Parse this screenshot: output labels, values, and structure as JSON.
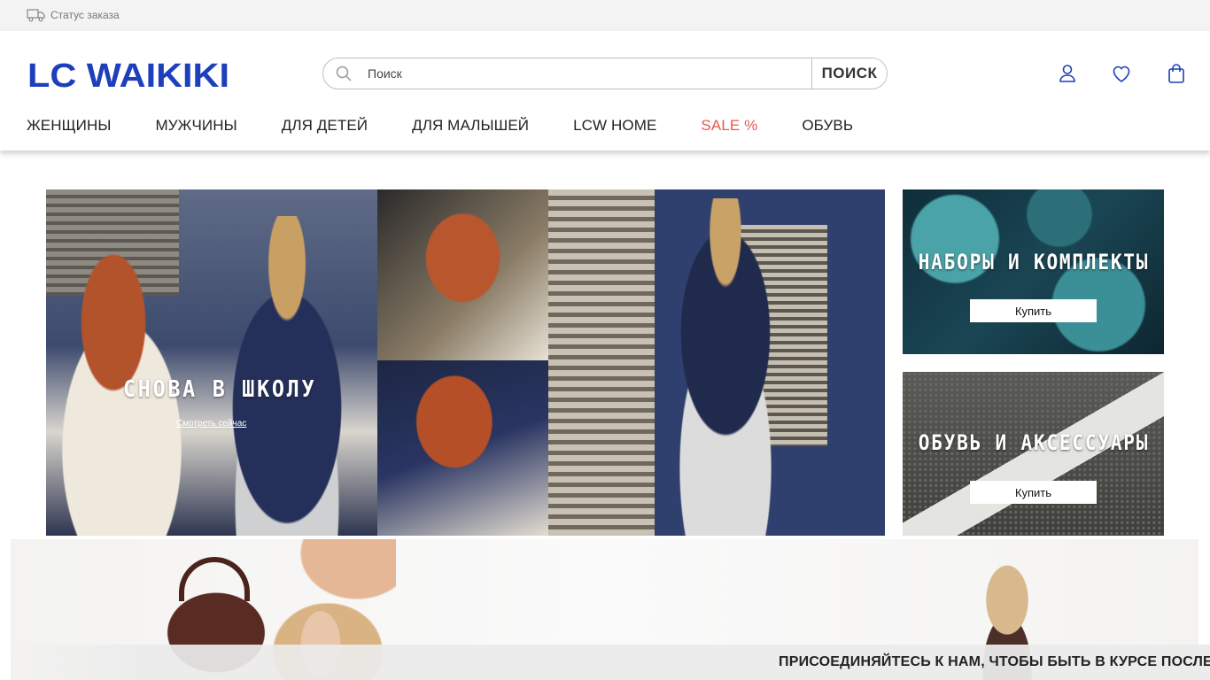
{
  "topbar": {
    "order_status": "Статус заказа"
  },
  "header": {
    "logo": "LC WAIKIKI",
    "search": {
      "placeholder": "Поиск",
      "button": "ПОИСК"
    },
    "icons": [
      "user-icon",
      "heart-icon",
      "shopping-bag-icon"
    ]
  },
  "nav": {
    "items": [
      {
        "label": "ЖЕНЩИНЫ"
      },
      {
        "label": "МУЖЧИНЫ"
      },
      {
        "label": "ДЛЯ ДЕТЕЙ"
      },
      {
        "label": "ДЛЯ МАЛЫШЕЙ"
      },
      {
        "label": "LCW HOME"
      },
      {
        "label": "SALE %"
      },
      {
        "label": "ОБУВЬ"
      }
    ]
  },
  "hero": {
    "title": "СНОВА В ШКОЛУ",
    "link": "Смотреть сейчас"
  },
  "side_banners": [
    {
      "title": "НАБОРЫ И КОМПЛЕКТЫ",
      "button": "Купить"
    },
    {
      "title": "ОБУВЬ И АКСЕССУАРЫ",
      "button": "Купить"
    }
  ],
  "promo": {
    "join_text": "ПРИСОЕДИНЯЙТЕСЬ К НАМ, ЧТОБЫ БЫТЬ В КУРСЕ ПОСЛЕДН"
  },
  "colors": {
    "brand_blue": "#1d3fbb",
    "sale_red": "#e8584b"
  }
}
